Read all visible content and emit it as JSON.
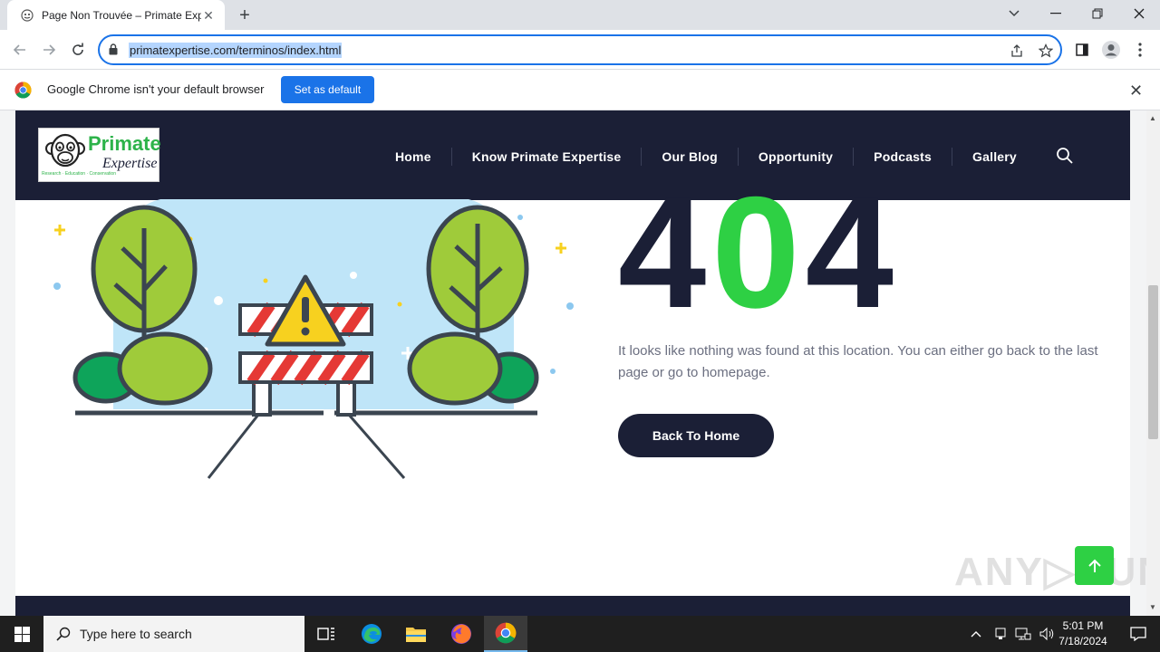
{
  "browser": {
    "tab_title": "Page Non Trouvée – Primate Exp",
    "url": "primatexpertise.com/terminos/index.html",
    "infobar_text": "Google Chrome isn't your default browser",
    "set_default_label": "Set as default"
  },
  "site": {
    "logo_primary": "Primate",
    "logo_secondary": "Expertise",
    "logo_tagline": "Research · Education · Conservation",
    "nav": [
      {
        "label": "Home"
      },
      {
        "label": "Know Primate Expertise"
      },
      {
        "label": "Our Blog"
      },
      {
        "label": "Opportunity"
      },
      {
        "label": "Podcasts"
      },
      {
        "label": "Gallery"
      }
    ],
    "error_d1": "4",
    "error_d2": "0",
    "error_d3": "4",
    "message": "It looks like nothing was found at this location. You can either go back to the last page or go to homepage.",
    "back_label": "Back To Home",
    "watermark": "ANY▷RUN"
  },
  "taskbar": {
    "search_placeholder": "Type here to search",
    "time": "5:01 PM",
    "date": "7/18/2024"
  },
  "colors": {
    "navy": "#1b1f36",
    "green": "#2ed044",
    "chrome_blue": "#1a73e8"
  }
}
